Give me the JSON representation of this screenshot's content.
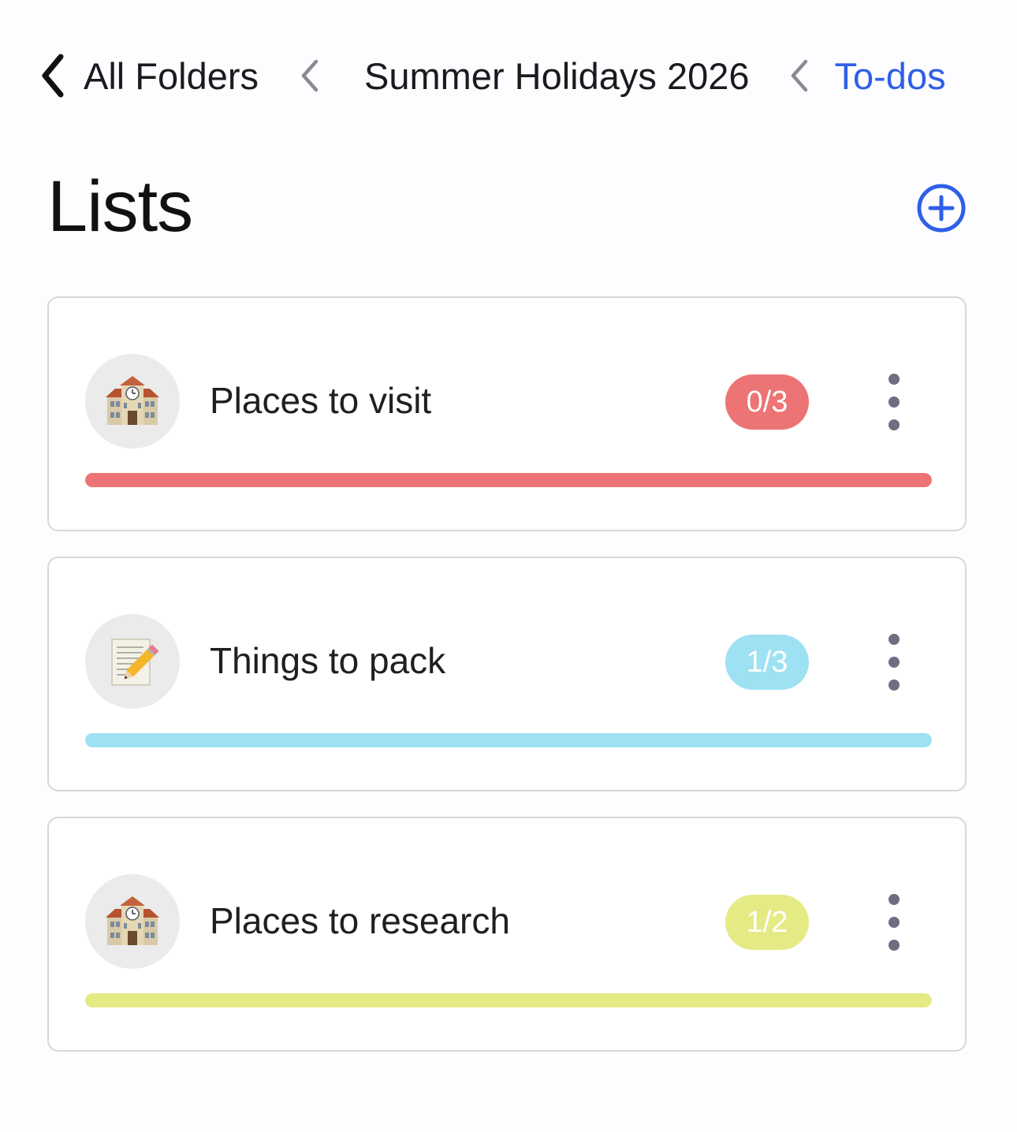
{
  "breadcrumb": {
    "all_folders": "All Folders",
    "folder": "Summer Holidays 2026",
    "current": "To-dos"
  },
  "header": {
    "title": "Lists",
    "add_icon": "plus-circle-icon"
  },
  "colors": {
    "accent": "#2f5ee8",
    "red": "#ec7474",
    "blue": "#9ee1f3",
    "yellow": "#e6ea84"
  },
  "lists": [
    {
      "icon": "school-building-icon",
      "title": "Places to visit",
      "badge": "0/3",
      "color": "#ec7474"
    },
    {
      "icon": "memo-pencil-icon",
      "title": "Things to pack",
      "badge": "1/3",
      "color": "#9ee1f3"
    },
    {
      "icon": "school-building-icon",
      "title": "Places to research",
      "badge": "1/2",
      "color": "#e6ea84"
    }
  ]
}
